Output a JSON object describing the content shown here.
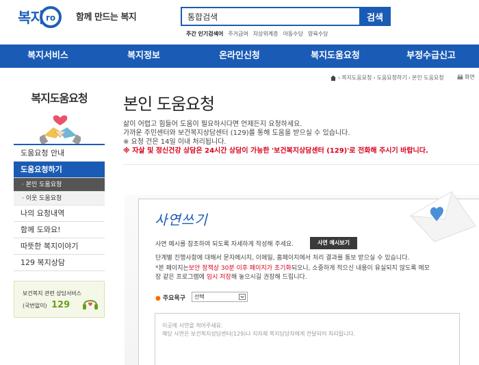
{
  "header": {
    "logo_text": "복지",
    "logo_suffix": "ro",
    "tagline": "함께 만드는 복지",
    "search": {
      "value": "통합검색",
      "button_label": "검색"
    },
    "hot_keywords": {
      "title": "주간 인기검색어",
      "items": [
        "주거급여",
        "차상위계층",
        "아동수당",
        "양육수당"
      ]
    }
  },
  "nav": {
    "items": [
      {
        "label": "복지서비스"
      },
      {
        "label": "복지정보"
      },
      {
        "label": "온라인신청"
      },
      {
        "label": "복지도움요청"
      },
      {
        "label": "부정수급신고"
      }
    ]
  },
  "breadcrumb": {
    "items": [
      "복지도움요청",
      "도움요청하기",
      "본인 도움요청"
    ],
    "print_label": "화면"
  },
  "sidebar": {
    "heading": "복지도움요청",
    "items": [
      {
        "label": "도움요청 안내"
      },
      {
        "label": "도움요청하기"
      },
      {
        "label": "· 본인 도움요청"
      },
      {
        "label": "· 이웃 도움요청"
      },
      {
        "label": "나의 요청내역"
      },
      {
        "label": "함께 도와요!"
      },
      {
        "label": "따뜻한 복지이야기"
      },
      {
        "label": "129 복지상담"
      }
    ],
    "banner": {
      "line1": "보건복지 관련 상담서비스",
      "line2": "(국번없이)",
      "number": "129"
    }
  },
  "main": {
    "title": "본인 도움요청",
    "intro": [
      "삶이 어렵고 힘들어 도움이 필요하시다면 언제든지 요청하세요.",
      "가까운 주민센터와 보건복지상담센터 (129)를 통해 도움을 받으실 수 있습니다.",
      "※ 요청 건은 14일 이내 처리됩니다."
    ],
    "warning": "※ 자살 및 정신건강 상담은 24시간 상담이 가능한 '보건복지상담센터 (129)'로 전화해 주시기 바랍니다."
  },
  "form": {
    "title": "사연쓰기",
    "line1": "사연 예시를 참조하여 되도록 자세하게 작성해 주세요.",
    "example_button": "사연 예시보기",
    "line2": "단계별 진행사항에 대해서 문자메시지, 이메일, 홈페이지에서 처리 결과를 통보 받으실 수 있습니다.",
    "note_prefix": "*본 페이지는",
    "note_red1": "보안 정책상 30분 이후 페이지가 초기화",
    "note_mid": "되오니, 소중하게 적으신 내용이 유실되지 않도록 메모",
    "note_line2_prefix": "장 같은 프로그램에",
    "note_red2": "임시 저장",
    "note_line2_suffix": "해 놓으시길 권장해 드립니다.",
    "req_label": "주요욕구",
    "req_select": "선택",
    "textarea_placeholder": [
      "이곳에 사연을 적어주세요.",
      "해당 사연은 보건복지상담센터(129)나 지자체 복지담당자에게 전달되어 처리됩니다."
    ]
  },
  "colors": {
    "brand": "#1a5bb5",
    "warning": "#d9001c",
    "accent_green": "#6a9f1e"
  }
}
